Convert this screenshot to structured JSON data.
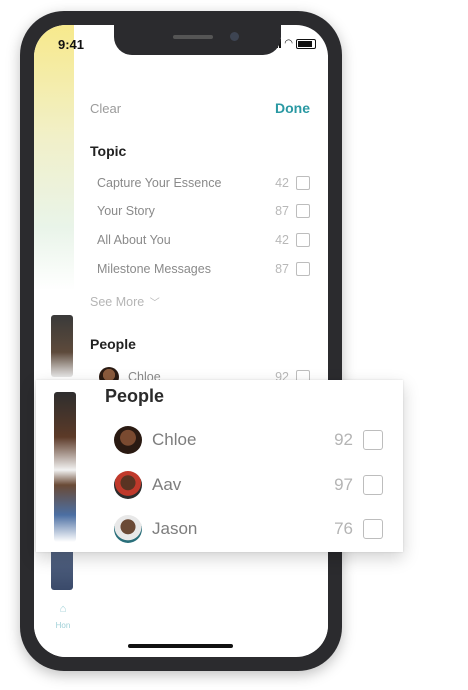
{
  "status_bar": {
    "time": "9:41"
  },
  "header": {
    "clear": "Clear",
    "done": "Done"
  },
  "topic": {
    "title": "Topic",
    "items": [
      {
        "label": "Capture Your Essence",
        "count": "42"
      },
      {
        "label": "Your Story",
        "count": "87"
      },
      {
        "label": "All About You",
        "count": "42"
      },
      {
        "label": "Milestone Messages",
        "count": "87"
      }
    ],
    "see_more": "See More"
  },
  "people": {
    "title": "People",
    "items": [
      {
        "label": "Chloe",
        "count": "92"
      }
    ]
  },
  "tabbar": {
    "home_label": "Hon"
  },
  "zoom_card": {
    "title": "People",
    "items": [
      {
        "label": "Chloe",
        "count": "92"
      },
      {
        "label": "Aav",
        "count": "97"
      },
      {
        "label": "Jason",
        "count": "76"
      }
    ]
  }
}
